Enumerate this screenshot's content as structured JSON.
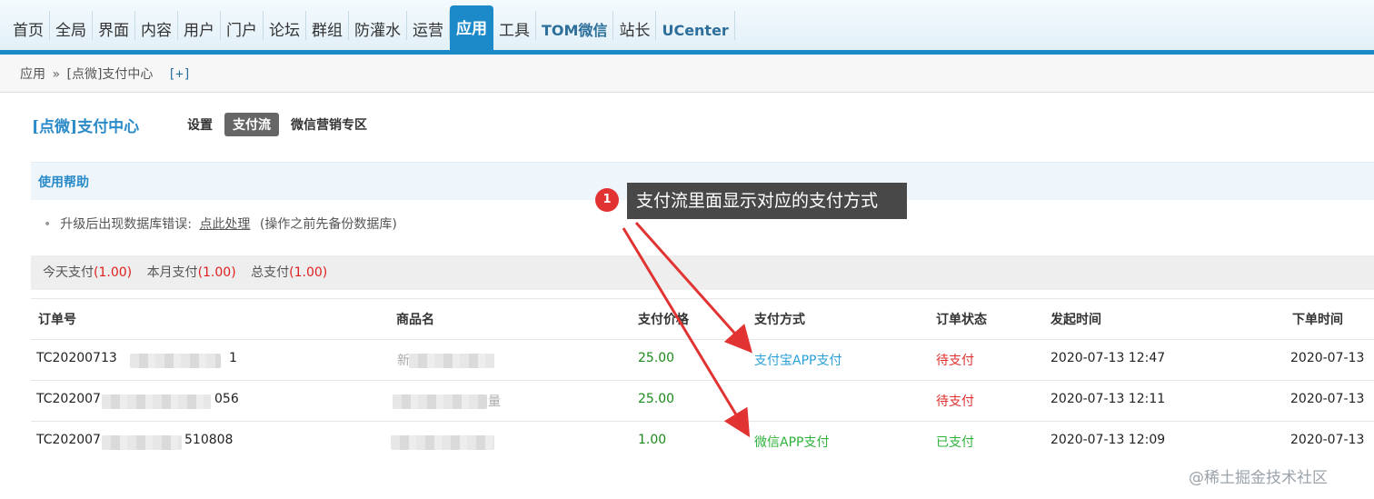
{
  "nav": {
    "items": [
      "首页",
      "全局",
      "界面",
      "内容",
      "用户",
      "门户",
      "论坛",
      "群组",
      "防灌水",
      "运营",
      "应用",
      "工具",
      "TOM微信",
      "站长",
      "UCenter"
    ],
    "active_index": 10
  },
  "breadcrumb": {
    "root": "应用",
    "separator": "»",
    "current": "[点微]支付中心",
    "add": "[+]"
  },
  "plugin": {
    "title": "[点微]支付中心",
    "tabs": [
      "设置",
      "支付流",
      "微信营销专区"
    ],
    "active_tab": 1
  },
  "help": {
    "heading": "使用帮助",
    "bullet": "•",
    "text": "升级后出现数据库错误:",
    "link": "点此处理",
    "note": "(操作之前先备份数据库)"
  },
  "summary": {
    "today_label": "今天支付",
    "today_value": "(1.00)",
    "month_label": "本月支付",
    "month_value": "(1.00)",
    "total_label": "总支付",
    "total_value": "(1.00)"
  },
  "table": {
    "headers": [
      "订单号",
      "商品名",
      "支付价格",
      "支付方式",
      "订单状态",
      "发起时间",
      "下单时间"
    ],
    "rows": [
      {
        "order_start": "TC20200713",
        "order_end": "1",
        "product_start": "新",
        "product_end": "",
        "price": "25.00",
        "method": "支付宝APP支付",
        "status": "待支付",
        "created": "2020-07-13 12:47",
        "ordered": "2020-07-13"
      },
      {
        "order_start": "TC202007",
        "order_end": "056",
        "product_start": "",
        "product_end": "量",
        "price": "25.00",
        "method": "",
        "status": "待支付",
        "created": "2020-07-13 12:11",
        "ordered": "2020-07-13"
      },
      {
        "order_start": "TC202007",
        "order_end": "510808",
        "product_start": "",
        "product_end": "",
        "price": "1.00",
        "method": "微信APP支付",
        "status": "已支付",
        "created": "2020-07-13 12:09",
        "ordered": "2020-07-13"
      }
    ]
  },
  "annotation": {
    "badge": "1",
    "text": "支付流里面显示对应的支付方式",
    "color": "#e23333"
  },
  "watermark": "@稀土掘金技术社区",
  "colors": {
    "accent": "#1c89c8",
    "price": "#1a8a1a",
    "alipay": "#2aa0d8",
    "wechat": "#2eb33a",
    "pending": "#e03030"
  }
}
